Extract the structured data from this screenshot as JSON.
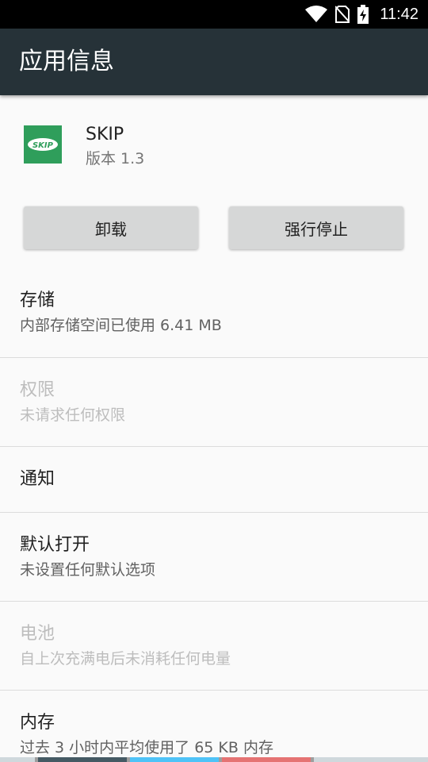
{
  "status_bar": {
    "time": "11:42",
    "icons": [
      "wifi-icon",
      "no-sim-icon",
      "battery-charging-icon"
    ]
  },
  "toolbar": {
    "title": "应用信息"
  },
  "app": {
    "name": "SKIP",
    "version": "版本 1.3",
    "icon_label": "SKIP",
    "icon_color": "#2f9e5b"
  },
  "buttons": {
    "uninstall": "卸载",
    "force_stop": "强行停止"
  },
  "items": {
    "storage": {
      "title": "存储",
      "summary": "内部存储空间已使用 6.41 MB"
    },
    "permissions": {
      "title": "权限",
      "summary": "未请求任何权限"
    },
    "notifications": {
      "title": "通知"
    },
    "default_open": {
      "title": "默认打开",
      "summary": "未设置任何默认选项"
    },
    "battery": {
      "title": "电池",
      "summary": "自上次充满电后未消耗任何电量"
    },
    "memory": {
      "title": "内存",
      "summary": "过去 3 小时内平均使用了 65 KB 内存"
    }
  },
  "colors": {
    "toolbar": "#263238",
    "background": "#fafafa",
    "button": "#d6d7d7",
    "disabled_text": "#bdbdbd"
  }
}
